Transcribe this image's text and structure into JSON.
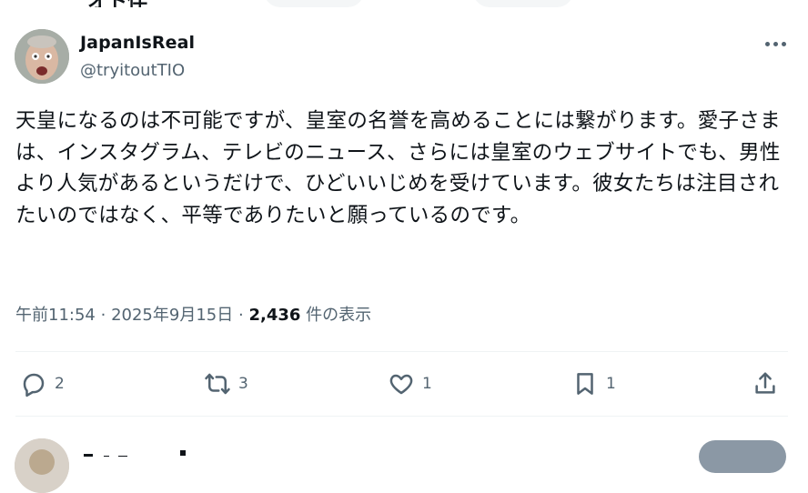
{
  "header": {
    "cut_title": "オト伴"
  },
  "tweet": {
    "author_name": "JapanIsReal",
    "author_handle": "@tryitoutTIO",
    "text": "天皇になるのは不可能ですが、皇室の名誉を高めることには繋がります。愛子さまは、インスタグラム、テレビのニュース、さらには皇室のウェブサイトでも、男性より人気があるというだけで、ひどいいじめを受けています。彼女たちは注目されたいのではなく、平等でありたいと願っているのです。",
    "time": "午前11:54",
    "date": "2025年9月15日",
    "separator": "·",
    "views_count": "2,436",
    "views_label": "件の表示"
  },
  "actions": {
    "reply_count": "2",
    "retweet_count": "3",
    "like_count": "1",
    "bookmark_count": "1"
  },
  "icons": [
    "more-icon",
    "reply-icon",
    "retweet-icon",
    "like-icon",
    "bookmark-icon",
    "share-icon"
  ],
  "colors": {
    "text": "#0f1419",
    "secondary": "#536471",
    "divider": "#eff3f4"
  }
}
